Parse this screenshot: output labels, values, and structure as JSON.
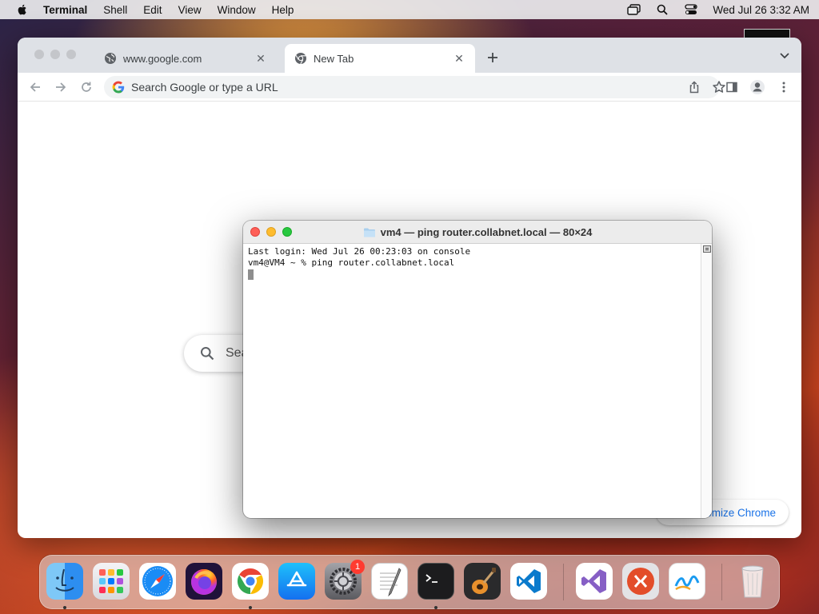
{
  "menubar": {
    "app_name": "Terminal",
    "items": [
      "Shell",
      "Edit",
      "View",
      "Window",
      "Help"
    ],
    "datetime": "Wed Jul 26  3:32 AM"
  },
  "chrome": {
    "tabs": [
      {
        "label": "www.google.com",
        "active": false
      },
      {
        "label": "New Tab",
        "active": true
      }
    ],
    "omnibox_placeholder": "Search Google or type a URL",
    "ntp_search_text": "Sea",
    "customize_label": "omize Chrome"
  },
  "terminal": {
    "title": "vm4 — ping router.collabnet.local — 80×24",
    "lines": [
      "Last login: Wed Jul 26 00:23:03 on console",
      "vm4@VM4 ~ % ping router.collabnet.local"
    ]
  },
  "dock": {
    "apps": [
      {
        "name": "finder",
        "running": true
      },
      {
        "name": "launchpad",
        "running": false
      },
      {
        "name": "safari",
        "running": false
      },
      {
        "name": "firefox",
        "running": false
      },
      {
        "name": "chrome",
        "running": true
      },
      {
        "name": "app-store",
        "running": false
      },
      {
        "name": "system-settings",
        "running": false,
        "badge": "1"
      },
      {
        "name": "textedit",
        "running": false
      },
      {
        "name": "terminal",
        "running": true
      },
      {
        "name": "garageband",
        "running": false
      },
      {
        "name": "vscode",
        "running": false
      },
      {
        "name": "visual-studio",
        "running": false
      },
      {
        "name": "remote-desktop",
        "running": false
      },
      {
        "name": "freeform",
        "running": false
      },
      {
        "name": "trash",
        "running": false
      }
    ]
  },
  "colors": {
    "accent_blue": "#1a73e8",
    "traffic_red": "#fe5f57",
    "traffic_yellow": "#febc2e",
    "traffic_green": "#28c840",
    "badge_red": "#ff3b30"
  }
}
